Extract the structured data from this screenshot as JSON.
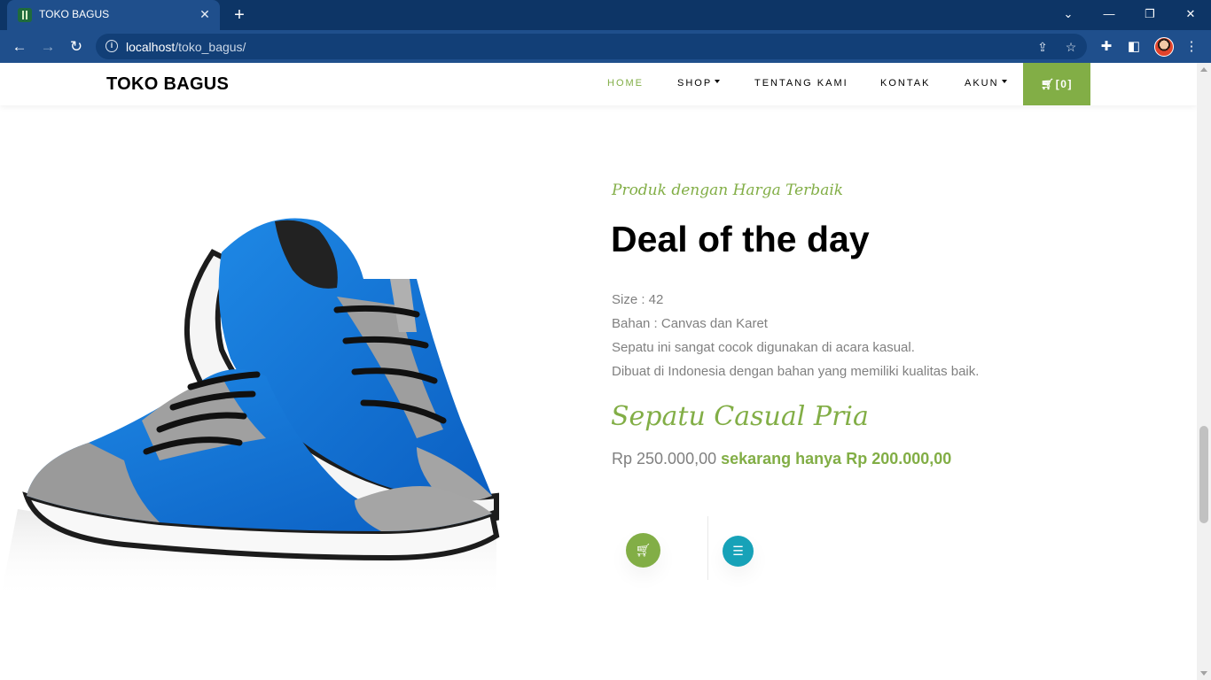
{
  "browser": {
    "tab_title": "TOKO BAGUS",
    "url_host": "localhost",
    "url_path": "/toko_bagus/"
  },
  "site": {
    "brand": "TOKO BAGUS",
    "nav": [
      {
        "label": "HOME",
        "active": true
      },
      {
        "label": "SHOP",
        "dropdown": true
      },
      {
        "label": "TENTANG KAMI"
      },
      {
        "label": "KONTAK"
      },
      {
        "label": "AKUN",
        "dropdown": true
      }
    ],
    "cart_label": "[0]"
  },
  "deal": {
    "subheading": "Produk dengan Harga Terbaik",
    "title": "Deal of the day",
    "description": [
      "Size : 42",
      "Bahan : Canvas dan Karet",
      "Sepatu ini sangat cocok digunakan di acara kasual.",
      "Dibuat di Indonesia dengan bahan yang memiliki kualitas baik."
    ],
    "product_name": "Sepatu Casual Pria",
    "old_price": "Rp 250.000,00",
    "new_price": "sekarang hanya Rp 200.000,00"
  },
  "colors": {
    "accent": "#82ae46",
    "info": "#17a2b8",
    "chrome": "#1f4f8c"
  },
  "icons": {
    "cart": "cart-icon",
    "detail": "menu-icon",
    "shoe": "blue-sneakers-image"
  }
}
